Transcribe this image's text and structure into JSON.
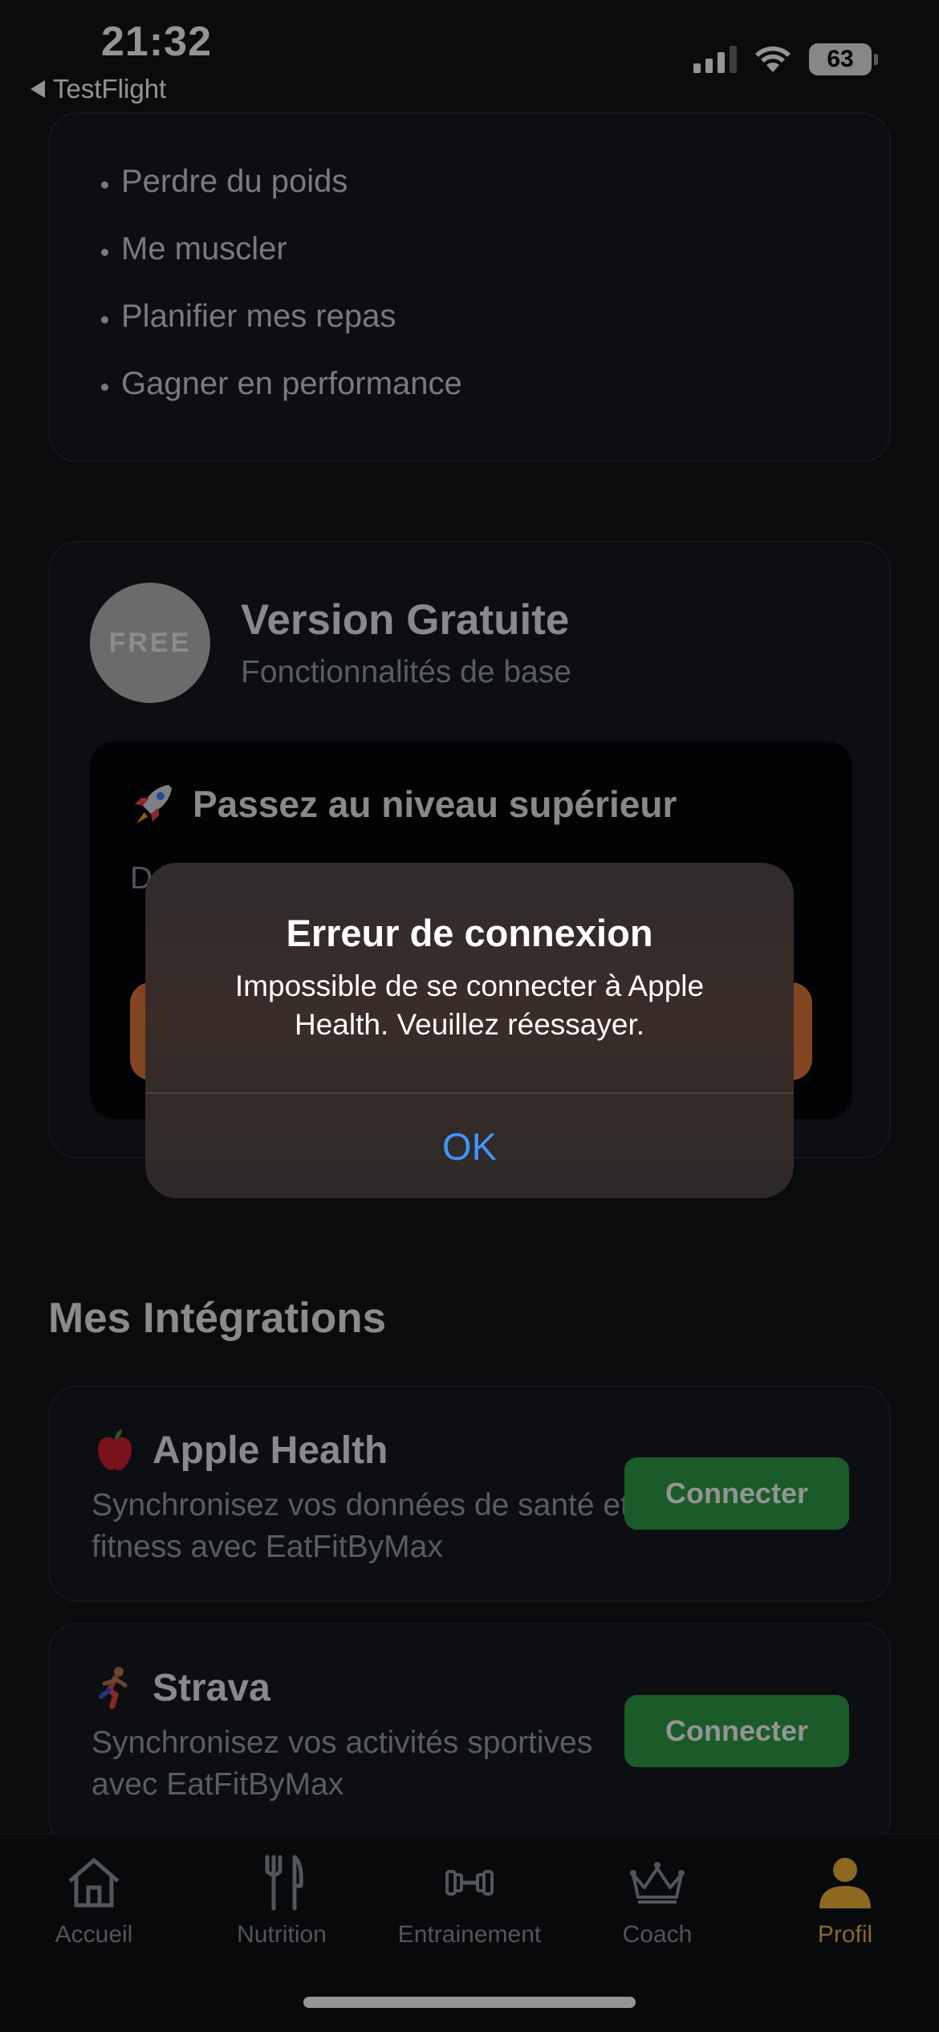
{
  "status_bar": {
    "time": "21:32",
    "back_app": "TestFlight",
    "battery": "63"
  },
  "goals": [
    "Perdre du poids",
    "Me muscler",
    "Planifier mes repas",
    "Gagner en performance"
  ],
  "plan": {
    "badge": "FREE",
    "title": "Version Gratuite",
    "subtitle": "Fonctionnalités de base",
    "upgrade_title": "Passez au niveau supérieur",
    "upgrade_desc_visible": "Dé"
  },
  "integrations": {
    "section_title": "Mes Intégrations",
    "apple_health": {
      "name": "Apple Health",
      "desc": "Synchronisez vos données de santé et fitness avec EatFitByMax",
      "button": "Connecter",
      "icon": "apple-icon"
    },
    "strava": {
      "name": "Strava",
      "desc": "Synchronisez vos activités sportives avec EatFitByMax",
      "button": "Connecter",
      "icon": "runner-icon"
    }
  },
  "tabs": [
    {
      "label": "Accueil",
      "icon": "home-icon",
      "active": false
    },
    {
      "label": "Nutrition",
      "icon": "fork-knife-icon",
      "active": false
    },
    {
      "label": "Entrainement",
      "icon": "dumbbell-icon",
      "active": false
    },
    {
      "label": "Coach",
      "icon": "crown-icon",
      "active": false
    },
    {
      "label": "Profil",
      "icon": "person-icon",
      "active": true
    }
  ],
  "alert": {
    "title": "Erreur de connexion",
    "message": "Impossible de se connecter à Apple Health. Veuillez réessayer.",
    "ok_label": "OK"
  },
  "colors": {
    "background": "#101317",
    "accent_active_tab": "#f2b43a",
    "connect_button": "#2e9e47",
    "upgrade_button": "#e07a3c",
    "alert_ok": "#3f95ff"
  }
}
